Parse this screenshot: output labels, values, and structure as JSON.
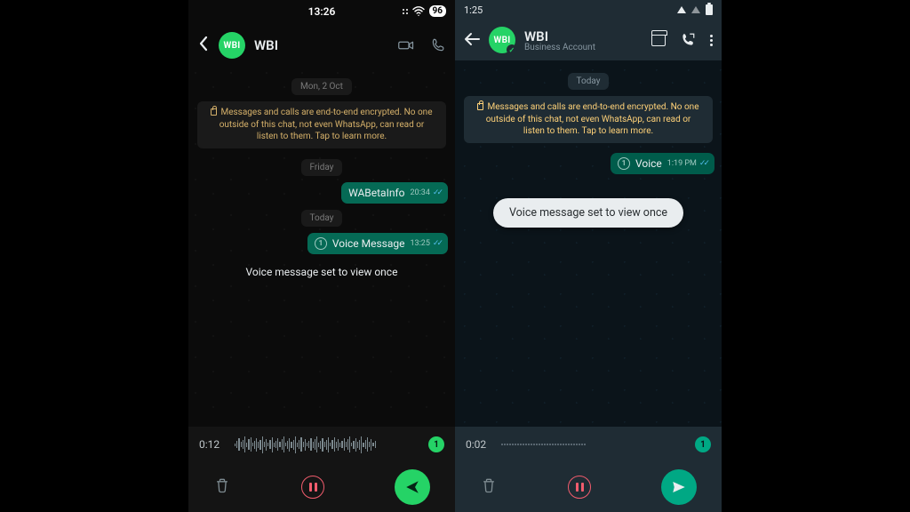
{
  "left": {
    "status": {
      "time": "13:26",
      "battery": "96"
    },
    "header": {
      "avatar_text": "WBI",
      "chat_name": "WBI"
    },
    "chat": {
      "date1": "Mon, 2 Oct",
      "encryption": "Messages and calls are end-to-end encrypted. No one outside of this chat, not even WhatsApp, can read or listen to them. Tap to learn more.",
      "date2": "Friday",
      "msg1": {
        "text": "WABetaInfo",
        "time": "20:34"
      },
      "date3": "Today",
      "msg2": {
        "text": "Voice Message",
        "time": "13:25"
      },
      "toast": "Voice message set to view once"
    },
    "recorder": {
      "time": "0:12",
      "once": "1"
    }
  },
  "right": {
    "status": {
      "time": "1:25"
    },
    "header": {
      "avatar_text": "WBI",
      "chat_name": "WBI",
      "subtitle": "Business Account"
    },
    "chat": {
      "date1": "Today",
      "encryption": "Messages and calls are end-to-end encrypted. No one outside of this chat, not even WhatsApp, can read or listen to them. Tap to learn more.",
      "msg1": {
        "text": "Voice",
        "time": "1:19 PM"
      },
      "toast": "Voice message set to view once"
    },
    "recorder": {
      "time": "0:02",
      "once": "1"
    }
  }
}
